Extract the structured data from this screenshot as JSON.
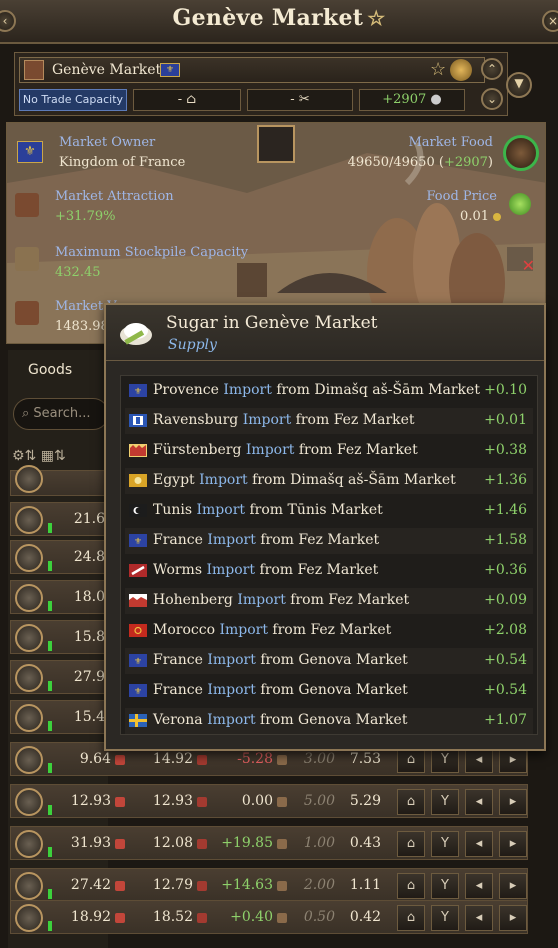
{
  "window": {
    "title": "Genève Market",
    "favorite_icon": "star-outline-icon"
  },
  "header": {
    "market_name": "Genève Market",
    "no_trade_capacity": "No Trade Capacity",
    "slot_one": "-",
    "slot_two": "-",
    "food_change": "+2907"
  },
  "info": {
    "owner_label": "Market Owner",
    "owner_value": "Kingdom of France",
    "food_label": "Market Food",
    "food_value": "49650/49650",
    "food_delta": "+2907",
    "attraction_label": "Market Attraction",
    "attraction_value": "+31.79%",
    "food_price_label": "Food Price",
    "food_price_value": "0.01",
    "stockpile_label": "Maximum Stockpile Capacity",
    "stockpile_value": "432.45",
    "market_value_label": "Market Va",
    "market_value_value": "1483.98"
  },
  "left_panel": {
    "goods_tab": "Goods",
    "search_placeholder": "Search..."
  },
  "partial_rows": [
    {
      "value": "21.6"
    },
    {
      "value": "24.8"
    },
    {
      "value": "18.0"
    },
    {
      "value": "15.8"
    },
    {
      "value": "27.9"
    },
    {
      "value": "15.4"
    }
  ],
  "rows": [
    {
      "a": "9.64",
      "b": "14.92",
      "c": "-5.28",
      "d": "3.00",
      "e": "7.53"
    },
    {
      "a": "12.93",
      "b": "12.93",
      "c": "0.00",
      "d": "5.00",
      "e": "5.29"
    },
    {
      "a": "31.93",
      "b": "12.08",
      "c": "+19.85",
      "d": "1.00",
      "e": "0.43"
    },
    {
      "a": "27.42",
      "b": "12.79",
      "c": "+14.63",
      "d": "2.00",
      "e": "1.11"
    },
    {
      "a": "18.92",
      "b": "18.52",
      "c": "+0.40",
      "d": "0.50",
      "e": "0.42"
    }
  ],
  "tooltip": {
    "title": "Sugar in Genève Market",
    "subtitle": "Supply",
    "entries": [
      {
        "country": "Provence",
        "word": "Import",
        "from": "from Dimašq aš-Šām Market",
        "value": "+0.10"
      },
      {
        "country": "Ravensburg",
        "word": "Import",
        "from": "from Fez Market",
        "value": "+0.01"
      },
      {
        "country": "Fürstenberg",
        "word": "Import",
        "from": "from Fez Market",
        "value": "+0.38"
      },
      {
        "country": "Egypt",
        "word": "Import",
        "from": "from Dimašq aš-Šām Market",
        "value": "+1.36"
      },
      {
        "country": "Tunis",
        "word": "Import",
        "from": "from Tūnis Market",
        "value": "+1.46"
      },
      {
        "country": "France",
        "word": "Import",
        "from": "from Fez Market",
        "value": "+1.58"
      },
      {
        "country": "Worms",
        "word": "Import",
        "from": "from Fez Market",
        "value": "+0.36"
      },
      {
        "country": "Hohenberg",
        "word": "Import",
        "from": "from Fez Market",
        "value": "+0.09"
      },
      {
        "country": "Morocco",
        "word": "Import",
        "from": "from Fez Market",
        "value": "+2.08"
      },
      {
        "country": "France",
        "word": "Import",
        "from": "from Genova Market",
        "value": "+0.54"
      },
      {
        "country": "France",
        "word": "Import",
        "from": "from Genova Market",
        "value": "+0.54"
      },
      {
        "country": "Verona",
        "word": "Import",
        "from": "from Genova Market",
        "value": "+1.07"
      }
    ]
  },
  "colors": {
    "accent_gold": "#b89560",
    "positive": "#8ed16b",
    "negative": "#e46060",
    "link_blue": "#8db8ea"
  }
}
